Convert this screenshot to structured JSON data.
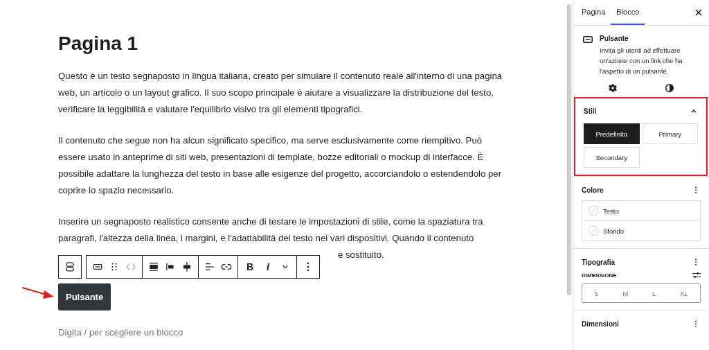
{
  "editor": {
    "title": "Pagina 1",
    "paragraphs": [
      "Questo è un testo segnaposto in lingua italiana, creato per simulare il contenuto reale all'interno di una pagina web, un articolo o un layout grafico. Il suo scopo principale è aiutare a visualizzare la distribuzione del testo, verificare la leggibilità e valutare l'equilibrio visivo tra gli elementi tipografici.",
      "Il contenuto che segue non ha alcun significato specifico, ma serve esclusivamente come riempitivo. Può essere usato in anteprime di siti web, presentazioni di template, bozze editoriali o mockup di interfacce. È possibile adattare la lunghezza del testo in base alle esigenze del progetto, accorciandolo o estendendolo per coprire lo spazio necessario.",
      "Inserire un segnaposto realistico consente anche di testare le impostazioni di stile, come la spaziatura tra paragrafi, l'altezza della linea, i margini, e l'adattabilità del testo nei vari dispositivi. Quando il contenuto"
    ],
    "covered_line_end": "e sostituito.",
    "toolbar": {
      "bold": "B",
      "italic": "I"
    },
    "button": "Pulsante",
    "placeholder": "Digita / per scegliere un blocco"
  },
  "sidebar": {
    "tabs": [
      {
        "label": "Pagina",
        "selected": false
      },
      {
        "label": "Blocco",
        "selected": true
      }
    ],
    "block": {
      "name": "Pulsante",
      "description": "Invita gli utenti ad effettuare un'azione con un link che ha l'aspetto di un pulsante."
    },
    "styles": {
      "title": "Stili",
      "expanded": true,
      "options": [
        {
          "label": "Predefinito",
          "selected": true
        },
        {
          "label": "Primary",
          "selected": false
        },
        {
          "label": "Secondary",
          "selected": false
        }
      ]
    },
    "color": {
      "title": "Colore",
      "items": [
        "Testo",
        "Sfondo"
      ]
    },
    "typography": {
      "title": "Tipografia",
      "size_label": "DIMENSIONE",
      "sizes": [
        "S",
        "M",
        "L",
        "XL"
      ]
    },
    "dimensions": {
      "title": "Dimensioni"
    }
  }
}
